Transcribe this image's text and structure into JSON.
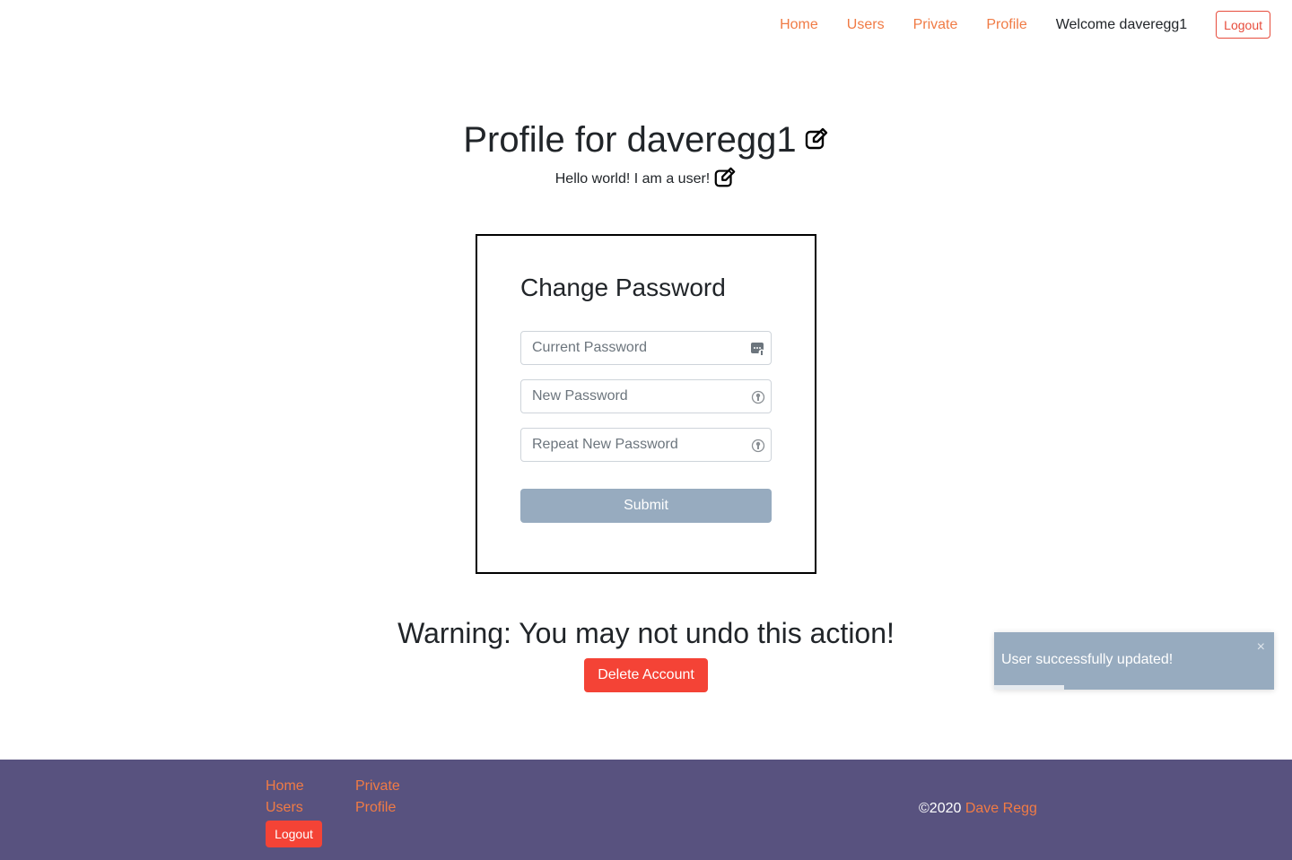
{
  "nav": {
    "links": [
      "Home",
      "Users",
      "Private",
      "Profile"
    ],
    "welcome": "Welcome daveregg1",
    "logout": "Logout"
  },
  "profile": {
    "title": "Profile for daveregg1",
    "bio": "Hello world! I am a user!"
  },
  "change_password": {
    "title": "Change Password",
    "current_placeholder": "Current Password",
    "new_placeholder": "New Password",
    "repeat_placeholder": "Repeat New Password",
    "submit": "Submit"
  },
  "danger": {
    "warning": "Warning: You may not undo this action!",
    "delete": "Delete Account"
  },
  "toast": {
    "message": "User successfully updated!",
    "close": "×",
    "progress": 0.25
  },
  "footer": {
    "col1": [
      "Home",
      "Users"
    ],
    "col2": [
      "Private",
      "Profile"
    ],
    "logout": "Logout",
    "copyright": "©2020",
    "author": "Dave Regg"
  },
  "colors": {
    "accent": "#f07b45",
    "danger": "#f44336",
    "footer_bg": "#58527f",
    "toast_bg": "#97abbf"
  },
  "icons": {
    "edit": "pencil-square-icon",
    "password_manager": "keychain-icon",
    "password_suggest": "key-circle-icon"
  }
}
